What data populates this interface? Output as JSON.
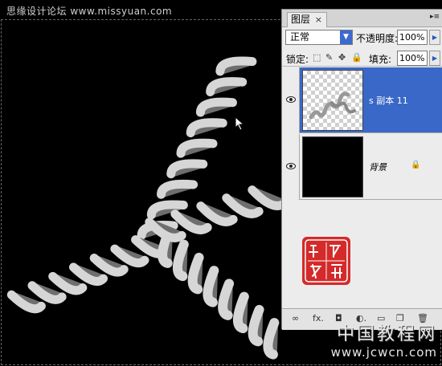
{
  "watermark_top": "思缘设计论坛  www.missyuan.com",
  "layers_panel": {
    "tab_label": "图层",
    "tab_close": "×",
    "menu_button": "▸≡",
    "blend_mode": "正常",
    "opacity_label": "不透明度:",
    "opacity_value": "100%",
    "lock_label": "锁定:",
    "fill_label": "填充:",
    "fill_value": "100%",
    "layers": [
      {
        "name": "s 副本 11",
        "selected": true,
        "visible": true
      },
      {
        "name": "背景",
        "selected": false,
        "visible": true,
        "locked": true
      }
    ],
    "footer_icons": [
      "link-icon",
      "fx-icon",
      "mask-icon",
      "adjustment-icon",
      "group-icon",
      "new-layer-icon",
      "trash-icon"
    ],
    "footer_labels": [
      "∞",
      "fx.",
      "◘",
      "◐.",
      "▭",
      "❐",
      "🗑"
    ]
  },
  "seal_text": [
    "淅",
    "濡",
    "谷",
    "客"
  ],
  "watermark_bottom": {
    "cn": "中国教程网",
    "url": "www.jcwcn.com"
  },
  "colors": {
    "selection": "#3a68c8",
    "seal": "#d42a2a",
    "accent_blue": "#2d57b8"
  }
}
